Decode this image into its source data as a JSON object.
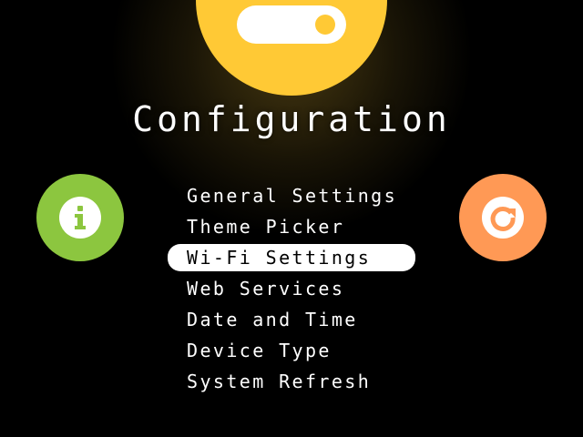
{
  "header": {
    "title": "Configuration",
    "hero_icon": "toggle-switch-icon"
  },
  "side_buttons": {
    "info": {
      "icon": "info-icon",
      "color": "#8cc63f"
    },
    "refresh": {
      "icon": "refresh-icon",
      "color": "#ff9955"
    }
  },
  "menu": {
    "items": [
      {
        "label": "General Settings"
      },
      {
        "label": "Theme Picker"
      },
      {
        "label": "Wi-Fi Settings"
      },
      {
        "label": "Web Services"
      },
      {
        "label": "Date and Time"
      },
      {
        "label": "Device Type"
      },
      {
        "label": "System Refresh"
      }
    ],
    "selected_label": "Wi-Fi Settings"
  },
  "colors": {
    "background": "#000000",
    "accent": "#ffc935",
    "text": "#ffffff",
    "selection": "#ffffff"
  }
}
